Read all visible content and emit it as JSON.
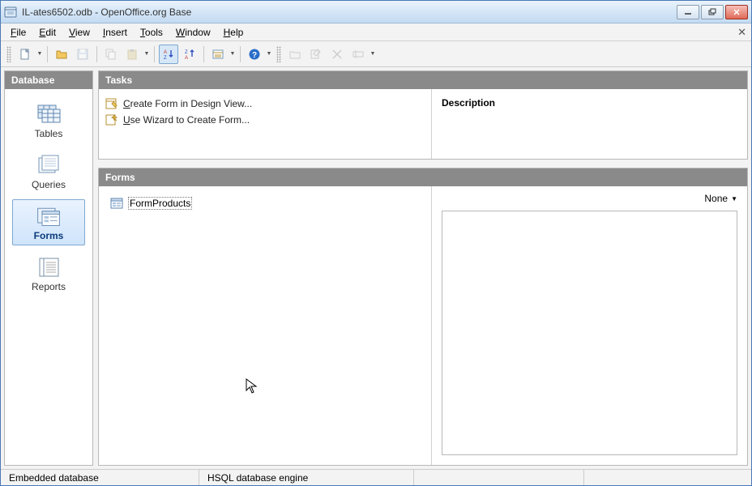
{
  "window": {
    "title": "IL-ates6502.odb - OpenOffice.org Base"
  },
  "menu": {
    "file": "File",
    "edit": "Edit",
    "view": "View",
    "insert": "Insert",
    "tools": "Tools",
    "window": "Window",
    "help": "Help"
  },
  "sidebar": {
    "header": "Database",
    "tables": "Tables",
    "queries": "Queries",
    "forms": "Forms",
    "reports": "Reports"
  },
  "tasks": {
    "header": "Tasks",
    "create_design": "Create Form in Design View...",
    "use_wizard": "Use Wizard to Create Form...",
    "description_label": "Description"
  },
  "forms": {
    "header": "Forms",
    "items": [
      {
        "name": "FormProducts"
      }
    ],
    "preview_mode": "None"
  },
  "statusbar": {
    "embedded": "Embedded database",
    "engine": "HSQL database engine"
  }
}
